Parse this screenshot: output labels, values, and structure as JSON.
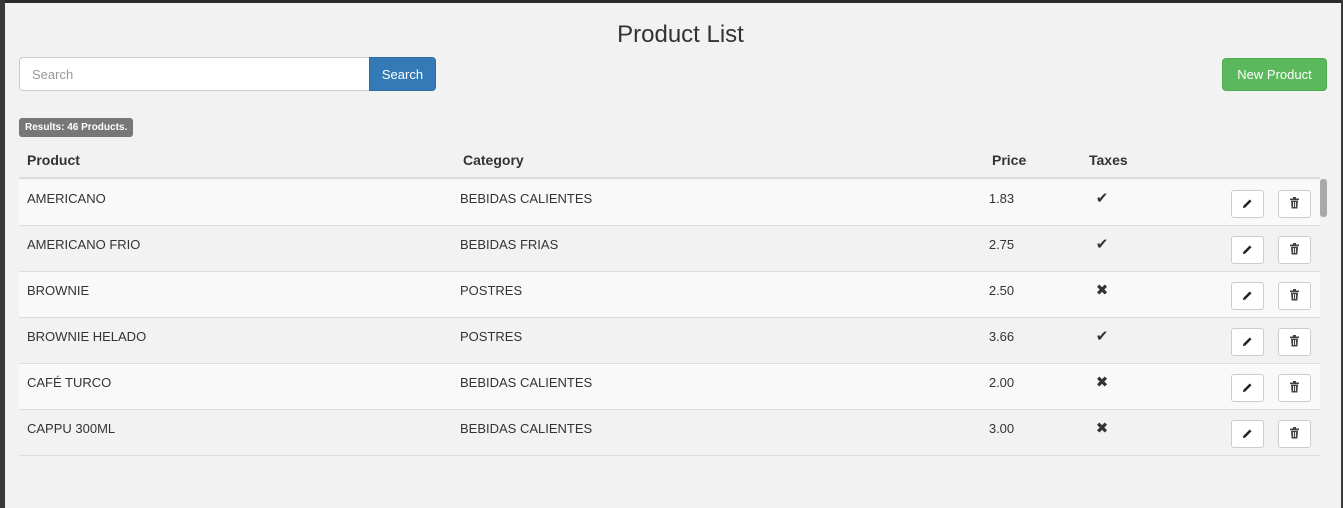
{
  "page": {
    "title": "Product List"
  },
  "search": {
    "placeholder": "Search",
    "value": "",
    "button_label": "Search"
  },
  "toolbar": {
    "new_product_label": "New Product"
  },
  "results": {
    "text": "Results: 46 Products."
  },
  "table": {
    "headers": {
      "product": "Product",
      "category": "Category",
      "price": "Price",
      "taxes": "Taxes"
    },
    "rows": [
      {
        "product": "AMERICANO",
        "category": "BEBIDAS CALIENTES",
        "price": "1.83",
        "taxes": "✔"
      },
      {
        "product": "AMERICANO FRIO",
        "category": "BEBIDAS FRIAS",
        "price": "2.75",
        "taxes": "✔"
      },
      {
        "product": "BROWNIE",
        "category": "POSTRES",
        "price": "2.50",
        "taxes": "✖"
      },
      {
        "product": "BROWNIE HELADO",
        "category": "POSTRES",
        "price": "3.66",
        "taxes": "✔"
      },
      {
        "product": "CAFÉ TURCO",
        "category": "BEBIDAS CALIENTES",
        "price": "2.00",
        "taxes": "✖"
      },
      {
        "product": "CAPPU 300ML",
        "category": "BEBIDAS CALIENTES",
        "price": "3.00",
        "taxes": "✖"
      }
    ]
  },
  "icons": {
    "edit": "pencil-icon",
    "delete": "trash-icon",
    "tax_yes": "check-icon",
    "tax_no": "cross-icon"
  },
  "colors": {
    "primary": "#337ab7",
    "success": "#5cb85c",
    "badge": "#777777",
    "background": "#f2f2f2"
  }
}
